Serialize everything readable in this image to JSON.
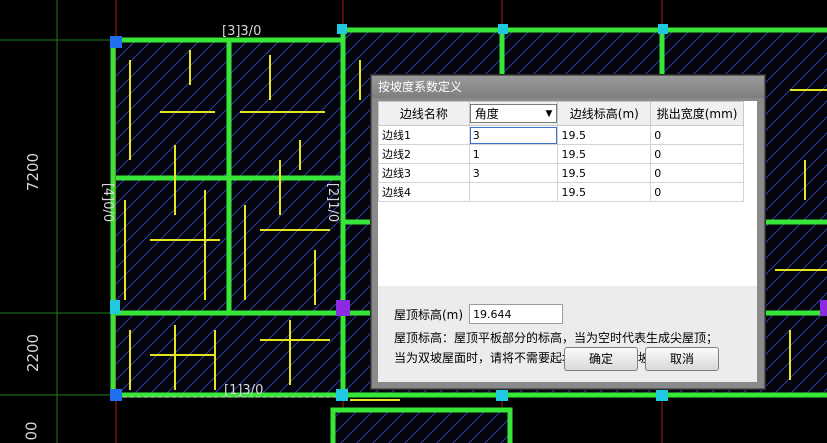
{
  "cad": {
    "dim_left_upper": "7200",
    "dim_left_lower": "2200",
    "dim_left_bottom": "00",
    "axis_top": "[3]3/0",
    "axis_bottom": "[1]3/0",
    "axis_left": "[4]0/0",
    "axis_mid": "[2]1/0"
  },
  "dialog": {
    "title": "按坡度系数定义",
    "columns": [
      "边线名称",
      "角度",
      "边线标高(m)",
      "挑出宽度(mm)"
    ],
    "rows": [
      {
        "name": "边线1",
        "angle": "3",
        "elev": "19.5",
        "width": "0"
      },
      {
        "name": "边线2",
        "angle": "1",
        "elev": "19.5",
        "width": "0"
      },
      {
        "name": "边线3",
        "angle": "3",
        "elev": "19.5",
        "width": "0"
      },
      {
        "name": "边线4",
        "angle": "",
        "elev": "19.5",
        "width": "0"
      }
    ],
    "roof_label": "屋顶标高(m)",
    "roof_value": "19.644",
    "note1": "屋顶标高：屋顶平板部分的标高，当为空时代表生成尖屋顶；",
    "note2": "当为双坡屋面时，请将不需要起坡的板边角度/坡度系数清空；",
    "ok": "确定",
    "cancel": "取消"
  }
}
